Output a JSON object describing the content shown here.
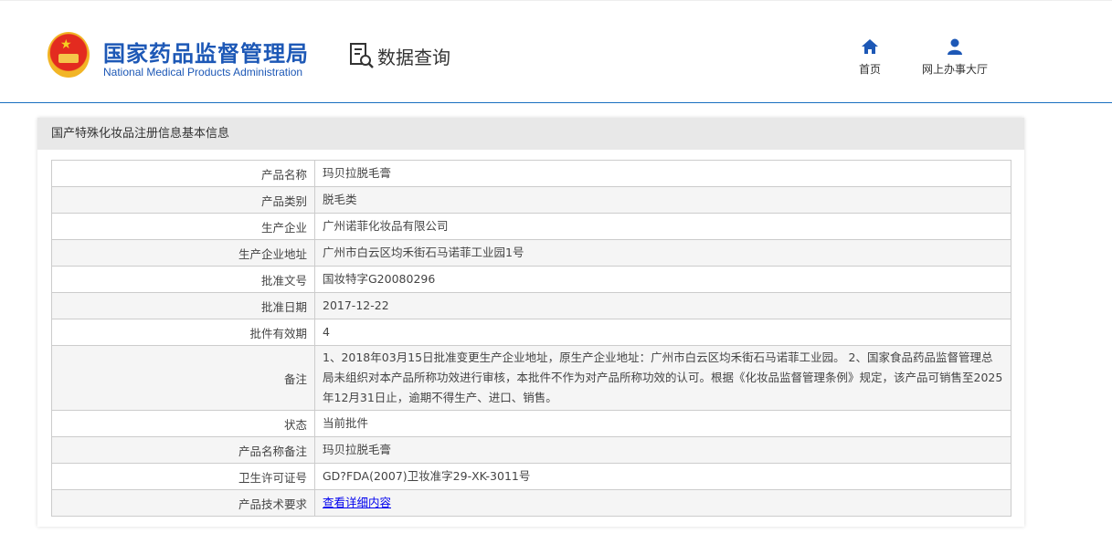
{
  "header": {
    "logo_cn": "国家药品监督管理局",
    "logo_en": "National Medical Products Administration",
    "section": "数据查询",
    "nav": [
      {
        "label": "首页",
        "icon": "home-icon"
      },
      {
        "label": "网上办事大厅",
        "icon": "user-icon"
      }
    ]
  },
  "panel": {
    "title": "国产特殊化妆品注册信息基本信息"
  },
  "rows": [
    {
      "label": "产品名称",
      "value": "玛贝拉脱毛膏"
    },
    {
      "label": "产品类别",
      "value": "脱毛类"
    },
    {
      "label": "生产企业",
      "value": "广州诺菲化妆品有限公司"
    },
    {
      "label": "生产企业地址",
      "value": "广州市白云区均禾街石马诺菲工业园1号"
    },
    {
      "label": "批准文号",
      "value": "国妆特字G20080296"
    },
    {
      "label": "批准日期",
      "value": "2017-12-22"
    },
    {
      "label": "批件有效期",
      "value": "4"
    },
    {
      "label": "备注",
      "value": "1、2018年03月15日批准变更生产企业地址，原生产企业地址：广州市白云区均禾街石马诺菲工业园。 2、国家食品药品监督管理总局未组织对本产品所称功效进行审核，本批件不作为对产品所称功效的认可。根据《化妆品监督管理条例》规定，该产品可销售至2025年12月31日止，逾期不得生产、进口、销售。"
    },
    {
      "label": "状态",
      "value": "当前批件"
    },
    {
      "label": "产品名称备注",
      "value": "玛贝拉脱毛膏"
    },
    {
      "label": "卫生许可证号",
      "value": "GD?FDA(2007)卫妆准字29-XK-3011号"
    },
    {
      "label": "产品技术要求",
      "value": "查看详细内容"
    }
  ]
}
